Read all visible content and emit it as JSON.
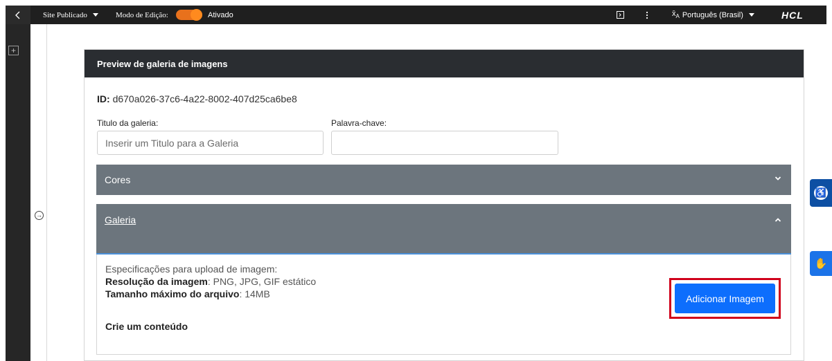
{
  "toolbar": {
    "site_label": "Site Publicado",
    "edit_mode_label": "Modo de Edição:",
    "edit_mode_state": "Ativado",
    "language": "Português (Brasil)",
    "brand": "HCL"
  },
  "panel": {
    "title": "Preview de galeria de imagens",
    "id_label": "ID:",
    "id_value": "d670a026-37c6-4a22-8002-407d25ca6be8",
    "title_field": {
      "label": "Titulo da galeria:",
      "placeholder": "Inserir um Titulo para a Galeria",
      "value": ""
    },
    "keyword_field": {
      "label": "Palavra-chave:",
      "placeholder": "",
      "value": ""
    },
    "sections": [
      {
        "label": "Cores",
        "expanded": false
      },
      {
        "label": "Galeria",
        "expanded": true
      }
    ],
    "gallery": {
      "spec_intro": "Especificações para upload de imagem:",
      "resolution_label": "Resolução da imagem",
      "resolution_value": ": PNG, JPG, GIF estático",
      "max_size_label": "Tamanho máximo do arquivo",
      "max_size_value": ": 14MB",
      "add_button": "Adicionar Imagem",
      "create_content": "Crie um conteúdo"
    }
  },
  "colors": {
    "accent_toggle": "#e8711c",
    "primary_button": "#0d6efd",
    "highlight_box": "#d0021b",
    "accordion": "#6c757d"
  }
}
